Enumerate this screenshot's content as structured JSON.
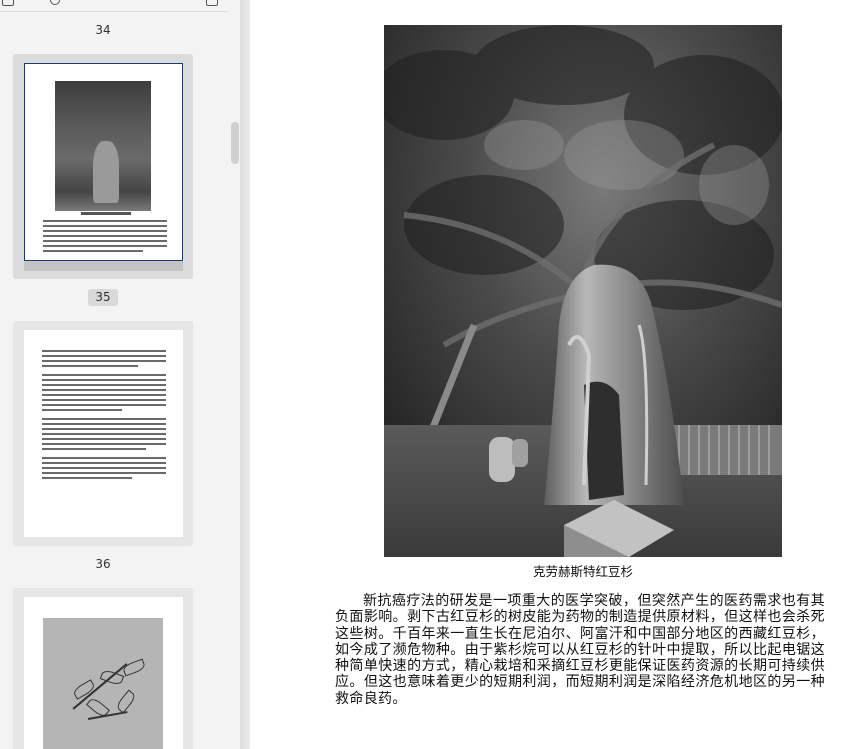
{
  "sidebar": {
    "thumbnails": [
      {
        "page_label": "34"
      },
      {
        "page_label": "35"
      },
      {
        "page_label": "36"
      }
    ]
  },
  "page": {
    "image_icon": "yew-tree-photo",
    "caption": "克劳赫斯特红豆杉",
    "paragraph": "新抗癌疗法的研发是一项重大的医学突破，但突然产生的医药需求也有其负面影响。剥下古红豆杉的树皮能为药物的制造提供原材料，但这样也会杀死这些树。千百年来一直生长在尼泊尔、阿富汗和中国部分地区的西藏红豆杉，如今成了濒危物种。由于紫杉烷可以从红豆杉的针叶中提取，所以比起电锯这种简单快速的方式，精心栽培和采摘红豆杉更能保证医药资源的长期可持续供应。但这也意味着更少的短期利润，而短期利润是深陷经济危机地区的另一种救命良药。"
  }
}
